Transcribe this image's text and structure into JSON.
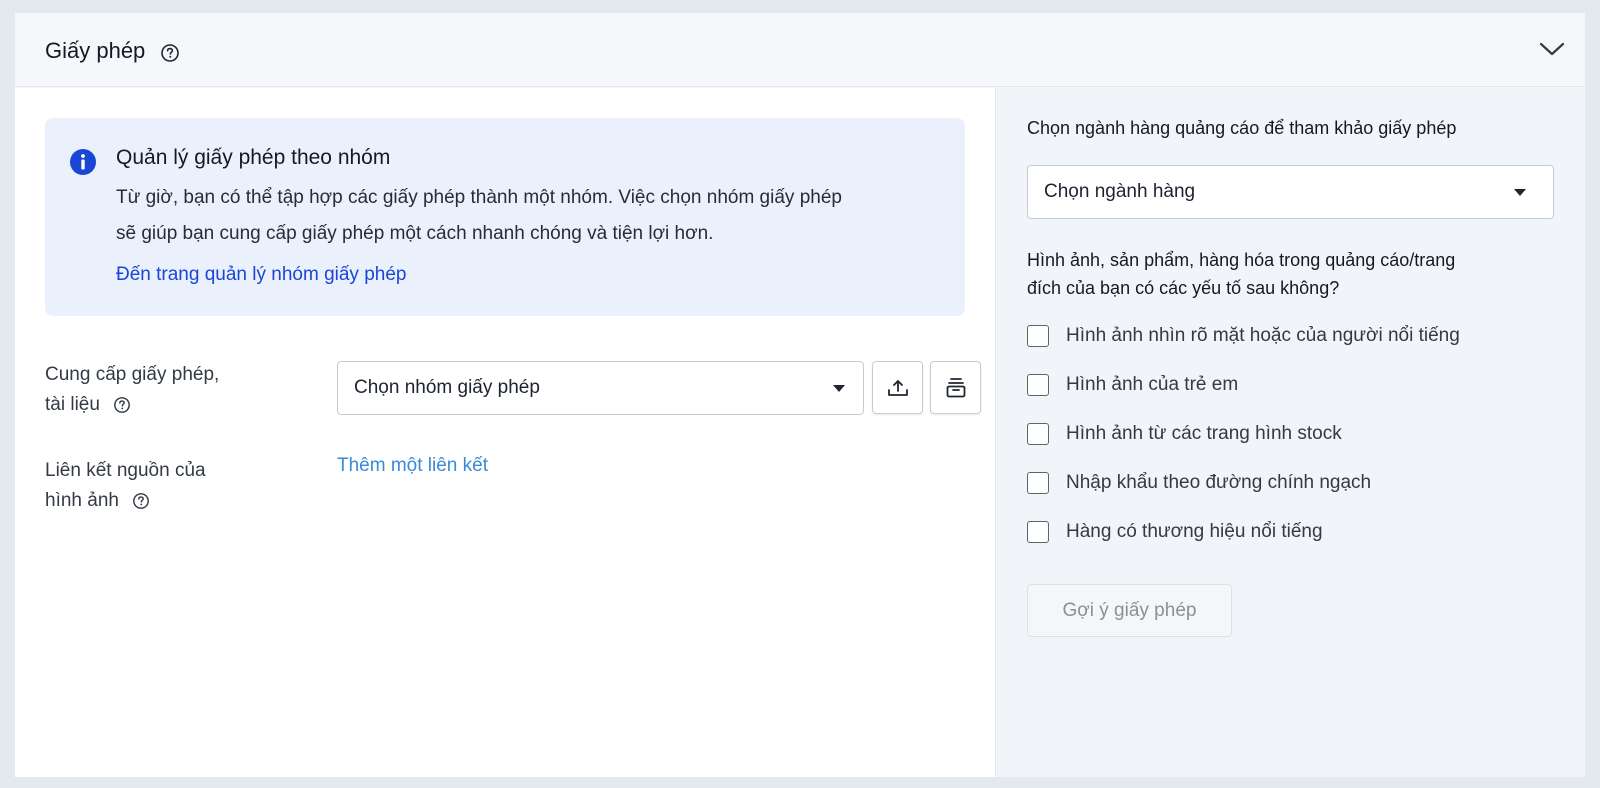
{
  "header": {
    "title": "Giấy phép"
  },
  "notice": {
    "title": "Quản lý giấy phép theo nhóm",
    "line1": "Từ giờ, bạn có thể tập hợp các giấy phép thành một nhóm. Việc chọn nhóm giấy phép",
    "line2": "sẽ giúp bạn cung cấp giấy phép một cách nhanh chóng và tiện lợi hơn.",
    "link": "Đến trang quản lý nhóm giấy phép"
  },
  "form": {
    "license_label_1": "Cung cấp giấy phép,",
    "license_label_2": "tài liệu",
    "license_select": "Chọn nhóm giấy phép",
    "source_label_1": "Liên kết nguồn của",
    "source_label_2": "hình ảnh",
    "add_link": "Thêm một liên kết"
  },
  "right": {
    "industry_label": "Chọn ngành hàng quảng cáo để tham khảo giấy phép",
    "industry_select": "Chọn ngành hàng",
    "question_1": "Hình ảnh, sản phẩm, hàng hóa trong quảng cáo/trang",
    "question_2": "đích của bạn có các yếu tố sau không?",
    "options": [
      "Hình ảnh nhìn rõ mặt hoặc của người nổi tiếng",
      "Hình ảnh của trẻ em",
      "Hình ảnh từ các trang hình stock",
      "Nhập khẩu theo đường chính ngạch",
      "Hàng có thương hiệu nổi tiếng"
    ],
    "suggest_button": "Gợi ý giấy phép"
  },
  "icons": {
    "help": "question-circle-icon",
    "collapse": "chevron-down-icon",
    "info": "info-circle-icon",
    "upload": "upload-icon",
    "archive": "archive-icon"
  },
  "colors": {
    "link_dark": "#1a46d6",
    "link_light": "#3a8ad6",
    "notice_bg": "#eaf0fc",
    "right_panel_bg": "#f1f4f8"
  }
}
